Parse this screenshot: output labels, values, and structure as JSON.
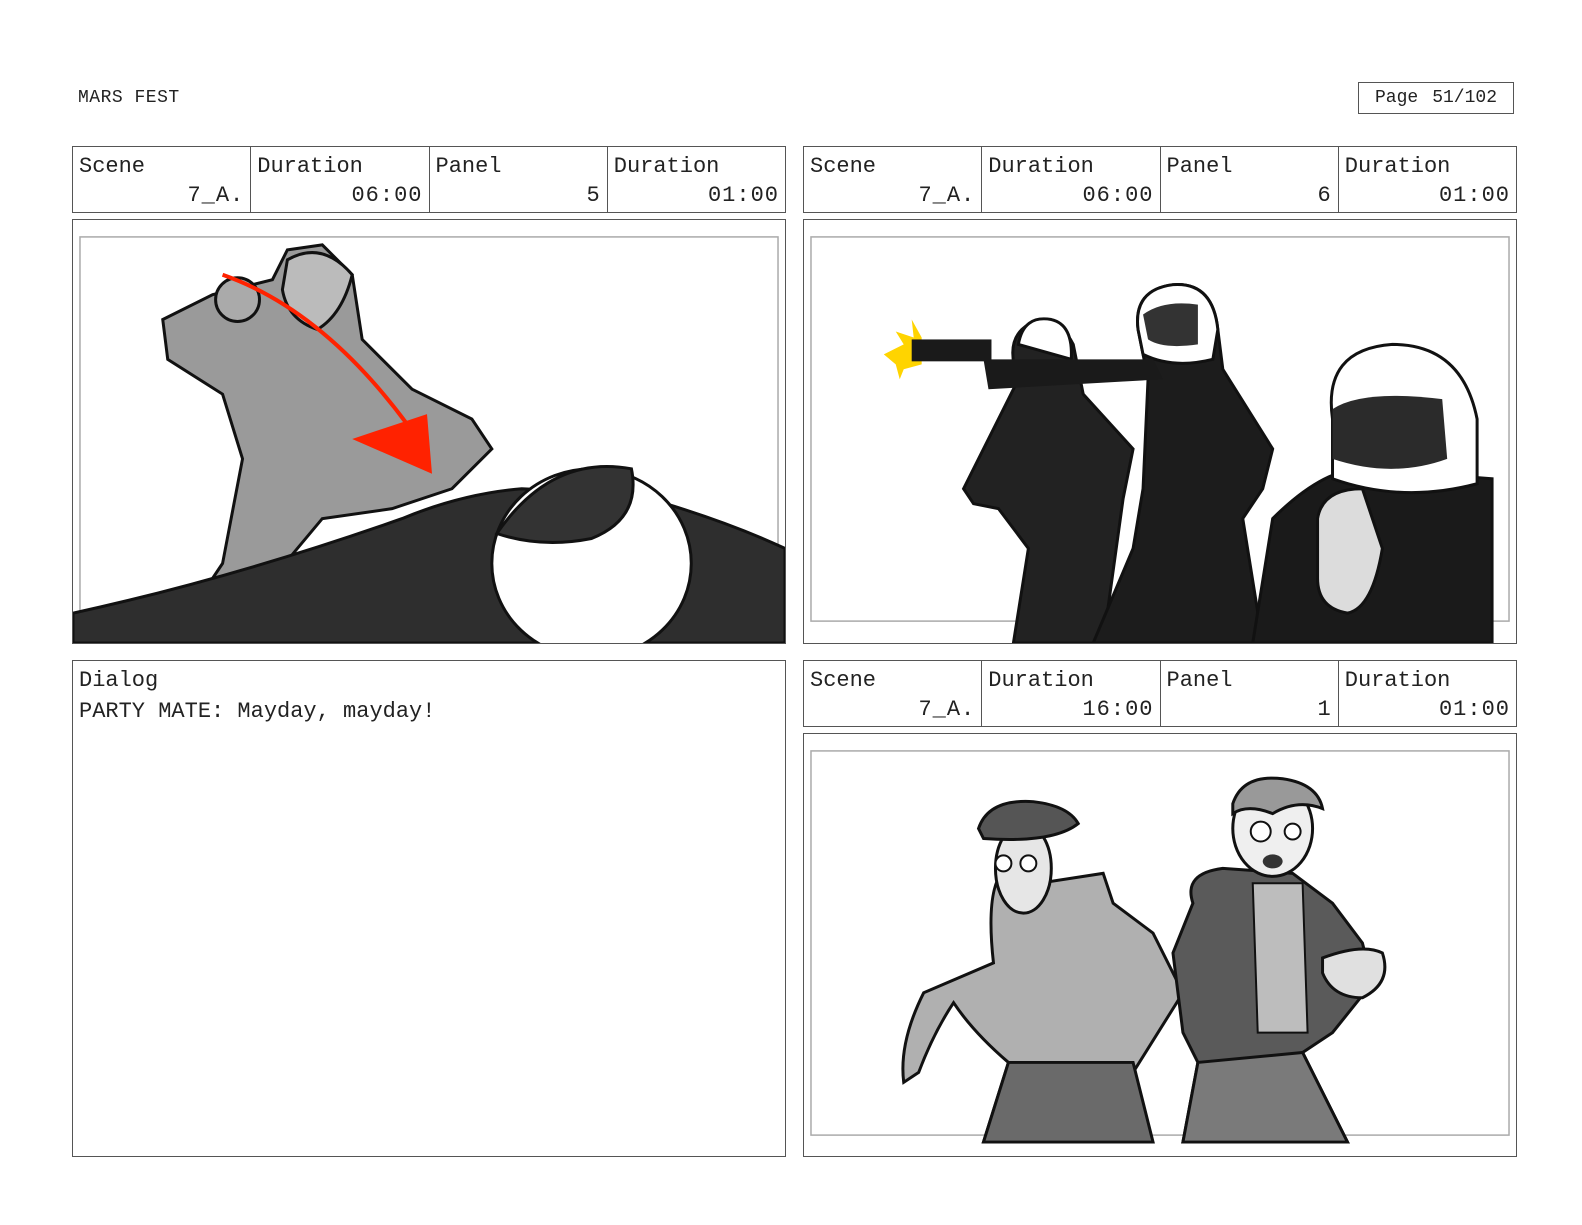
{
  "header": {
    "project_title": "MARS FEST",
    "page_label": "Page",
    "page_value": "51/102"
  },
  "panels": [
    {
      "scene_label": "Scene",
      "scene_value": "7_A.",
      "duration_label": "Duration",
      "duration_value": "06:00",
      "panel_label": "Panel",
      "panel_value": "5",
      "panel_duration_label": "Duration",
      "panel_duration_value": "01:00"
    },
    {
      "scene_label": "Scene",
      "scene_value": "7_A.",
      "duration_label": "Duration",
      "duration_value": "06:00",
      "panel_label": "Panel",
      "panel_value": "6",
      "panel_duration_label": "Duration",
      "panel_duration_value": "01:00"
    },
    {
      "scene_label": "Scene",
      "scene_value": "7_A.",
      "duration_label": "Duration",
      "duration_value": "16:00",
      "panel_label": "Panel",
      "panel_value": "1",
      "panel_duration_label": "Duration",
      "panel_duration_value": "01:00"
    }
  ],
  "dialog": {
    "label": "Dialog",
    "text": "PARTY MATE: Mayday, mayday!"
  },
  "colors": {
    "border": "#555555",
    "motion_arrow": "#ff2200",
    "muzzle_flash": "#ffd400"
  }
}
